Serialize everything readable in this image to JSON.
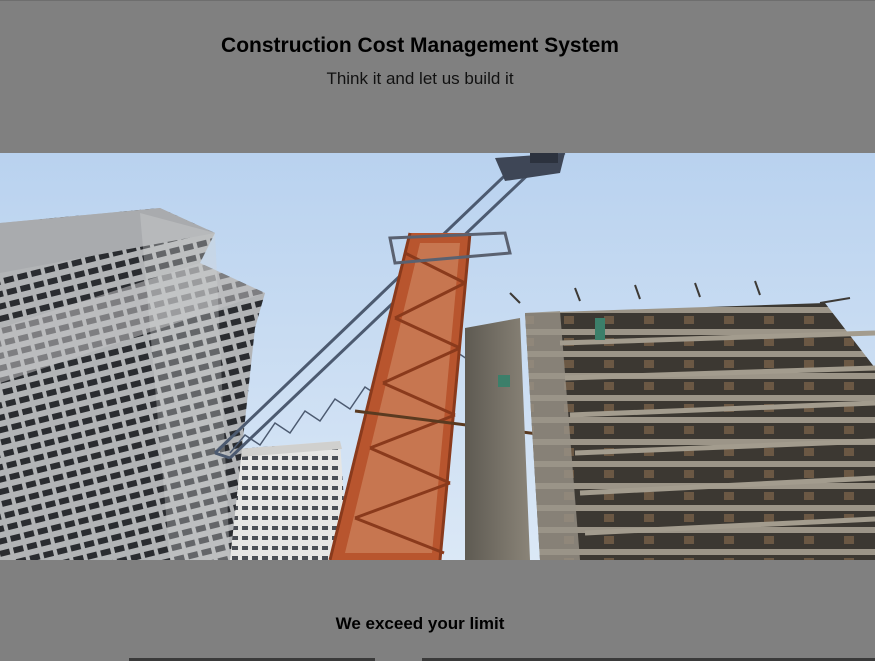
{
  "header": {
    "title": "Construction Cost Management System",
    "tagline": "Think it and let us build it"
  },
  "hero": {
    "image_subject": "construction-site-with-tower-crane"
  },
  "footer": {
    "slogan": "We exceed your limit"
  },
  "colors": {
    "page_background": "#808080",
    "sky": "#c5daf2",
    "crane": "#b8552e"
  }
}
